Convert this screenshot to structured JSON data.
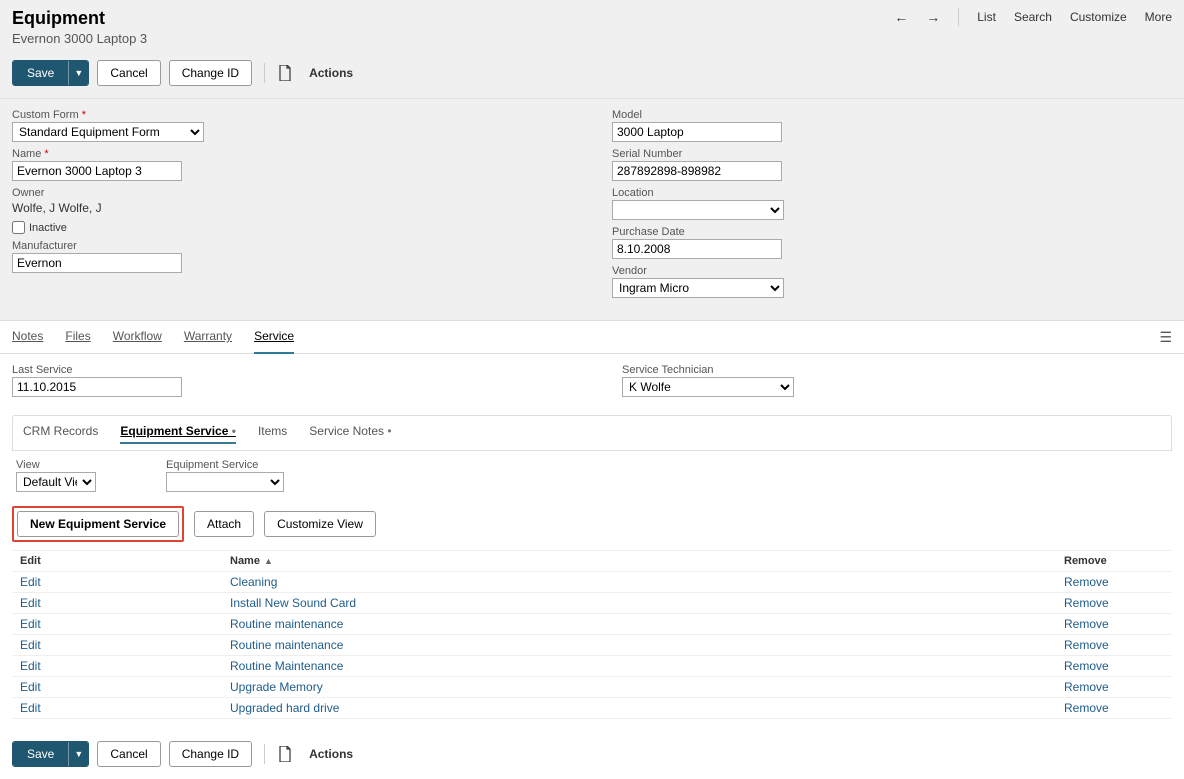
{
  "header": {
    "title": "Equipment",
    "subtitle": "Evernon 3000 Laptop 3",
    "nav": {
      "list": "List",
      "search": "Search",
      "customize": "Customize",
      "more": "More"
    },
    "buttons": {
      "save": "Save",
      "cancel": "Cancel",
      "change_id": "Change ID",
      "actions": "Actions"
    }
  },
  "form": {
    "left": {
      "custom_form_label": "Custom Form",
      "custom_form_value": "Standard Equipment Form",
      "name_label": "Name",
      "name_value": "Evernon 3000 Laptop 3",
      "owner_label": "Owner",
      "owner_value": "Wolfe, J Wolfe, J",
      "inactive_label": "Inactive",
      "manufacturer_label": "Manufacturer",
      "manufacturer_value": "Evernon"
    },
    "right": {
      "model_label": "Model",
      "model_value": "3000 Laptop",
      "serial_label": "Serial Number",
      "serial_value": "287892898-898982",
      "location_label": "Location",
      "location_value": "",
      "purchase_date_label": "Purchase Date",
      "purchase_date_value": "8.10.2008",
      "vendor_label": "Vendor",
      "vendor_value": "Ingram Micro"
    }
  },
  "tabs": {
    "notes": "Notes",
    "files": "Files",
    "workflow": "Workflow",
    "warranty": "Warranty",
    "service": "Service"
  },
  "service": {
    "last_service_label": "Last Service",
    "last_service_value": "11.10.2015",
    "technician_label": "Service Technician",
    "technician_value": "K Wolfe",
    "subtabs": {
      "crm": "CRM Records",
      "equipment_service": "Equipment Service",
      "items": "Items",
      "service_notes": "Service Notes"
    },
    "filters": {
      "view_label": "View",
      "view_value": "Default View",
      "es_label": "Equipment Service",
      "es_value": ""
    },
    "svc_buttons": {
      "new_es": "New Equipment Service",
      "attach": "Attach",
      "customize_view": "Customize View"
    },
    "table": {
      "headers": {
        "edit": "Edit",
        "name": "Name",
        "remove": "Remove"
      },
      "rows": [
        {
          "edit": "Edit",
          "name": "Cleaning",
          "remove": "Remove"
        },
        {
          "edit": "Edit",
          "name": "Install New Sound Card",
          "remove": "Remove"
        },
        {
          "edit": "Edit",
          "name": "Routine maintenance",
          "remove": "Remove"
        },
        {
          "edit": "Edit",
          "name": "Routine maintenance",
          "remove": "Remove"
        },
        {
          "edit": "Edit",
          "name": "Routine Maintenance",
          "remove": "Remove"
        },
        {
          "edit": "Edit",
          "name": "Upgrade Memory",
          "remove": "Remove"
        },
        {
          "edit": "Edit",
          "name": "Upgraded hard drive",
          "remove": "Remove"
        }
      ]
    }
  }
}
